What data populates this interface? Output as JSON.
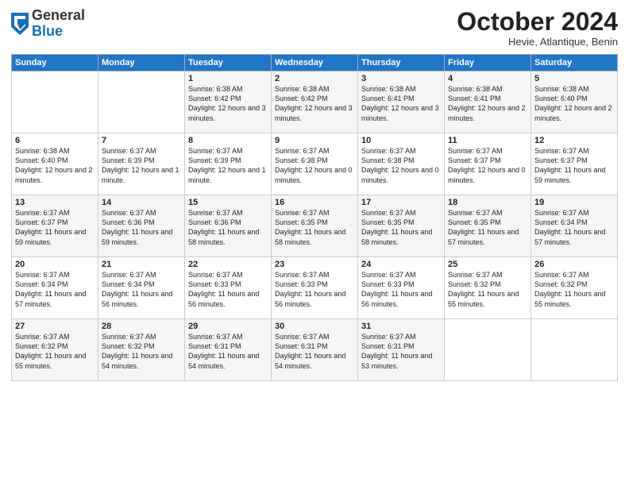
{
  "logo": {
    "general": "General",
    "blue": "Blue"
  },
  "header": {
    "month": "October 2024",
    "location": "Hevie, Atlantique, Benin"
  },
  "days_of_week": [
    "Sunday",
    "Monday",
    "Tuesday",
    "Wednesday",
    "Thursday",
    "Friday",
    "Saturday"
  ],
  "weeks": [
    [
      {
        "day": "",
        "detail": ""
      },
      {
        "day": "",
        "detail": ""
      },
      {
        "day": "1",
        "detail": "Sunrise: 6:38 AM\nSunset: 6:42 PM\nDaylight: 12 hours and 3 minutes."
      },
      {
        "day": "2",
        "detail": "Sunrise: 6:38 AM\nSunset: 6:42 PM\nDaylight: 12 hours and 3 minutes."
      },
      {
        "day": "3",
        "detail": "Sunrise: 6:38 AM\nSunset: 6:41 PM\nDaylight: 12 hours and 3 minutes."
      },
      {
        "day": "4",
        "detail": "Sunrise: 6:38 AM\nSunset: 6:41 PM\nDaylight: 12 hours and 2 minutes."
      },
      {
        "day": "5",
        "detail": "Sunrise: 6:38 AM\nSunset: 6:40 PM\nDaylight: 12 hours and 2 minutes."
      }
    ],
    [
      {
        "day": "6",
        "detail": "Sunrise: 6:38 AM\nSunset: 6:40 PM\nDaylight: 12 hours and 2 minutes."
      },
      {
        "day": "7",
        "detail": "Sunrise: 6:37 AM\nSunset: 6:39 PM\nDaylight: 12 hours and 1 minute."
      },
      {
        "day": "8",
        "detail": "Sunrise: 6:37 AM\nSunset: 6:39 PM\nDaylight: 12 hours and 1 minute."
      },
      {
        "day": "9",
        "detail": "Sunrise: 6:37 AM\nSunset: 6:38 PM\nDaylight: 12 hours and 0 minutes."
      },
      {
        "day": "10",
        "detail": "Sunrise: 6:37 AM\nSunset: 6:38 PM\nDaylight: 12 hours and 0 minutes."
      },
      {
        "day": "11",
        "detail": "Sunrise: 6:37 AM\nSunset: 6:37 PM\nDaylight: 12 hours and 0 minutes."
      },
      {
        "day": "12",
        "detail": "Sunrise: 6:37 AM\nSunset: 6:37 PM\nDaylight: 11 hours and 59 minutes."
      }
    ],
    [
      {
        "day": "13",
        "detail": "Sunrise: 6:37 AM\nSunset: 6:37 PM\nDaylight: 11 hours and 59 minutes."
      },
      {
        "day": "14",
        "detail": "Sunrise: 6:37 AM\nSunset: 6:36 PM\nDaylight: 11 hours and 59 minutes."
      },
      {
        "day": "15",
        "detail": "Sunrise: 6:37 AM\nSunset: 6:36 PM\nDaylight: 11 hours and 58 minutes."
      },
      {
        "day": "16",
        "detail": "Sunrise: 6:37 AM\nSunset: 6:35 PM\nDaylight: 11 hours and 58 minutes."
      },
      {
        "day": "17",
        "detail": "Sunrise: 6:37 AM\nSunset: 6:35 PM\nDaylight: 11 hours and 58 minutes."
      },
      {
        "day": "18",
        "detail": "Sunrise: 6:37 AM\nSunset: 6:35 PM\nDaylight: 11 hours and 57 minutes."
      },
      {
        "day": "19",
        "detail": "Sunrise: 6:37 AM\nSunset: 6:34 PM\nDaylight: 11 hours and 57 minutes."
      }
    ],
    [
      {
        "day": "20",
        "detail": "Sunrise: 6:37 AM\nSunset: 6:34 PM\nDaylight: 11 hours and 57 minutes."
      },
      {
        "day": "21",
        "detail": "Sunrise: 6:37 AM\nSunset: 6:34 PM\nDaylight: 11 hours and 56 minutes."
      },
      {
        "day": "22",
        "detail": "Sunrise: 6:37 AM\nSunset: 6:33 PM\nDaylight: 11 hours and 56 minutes."
      },
      {
        "day": "23",
        "detail": "Sunrise: 6:37 AM\nSunset: 6:33 PM\nDaylight: 11 hours and 56 minutes."
      },
      {
        "day": "24",
        "detail": "Sunrise: 6:37 AM\nSunset: 6:33 PM\nDaylight: 11 hours and 56 minutes."
      },
      {
        "day": "25",
        "detail": "Sunrise: 6:37 AM\nSunset: 6:32 PM\nDaylight: 11 hours and 55 minutes."
      },
      {
        "day": "26",
        "detail": "Sunrise: 6:37 AM\nSunset: 6:32 PM\nDaylight: 11 hours and 55 minutes."
      }
    ],
    [
      {
        "day": "27",
        "detail": "Sunrise: 6:37 AM\nSunset: 6:32 PM\nDaylight: 11 hours and 55 minutes."
      },
      {
        "day": "28",
        "detail": "Sunrise: 6:37 AM\nSunset: 6:32 PM\nDaylight: 11 hours and 54 minutes."
      },
      {
        "day": "29",
        "detail": "Sunrise: 6:37 AM\nSunset: 6:31 PM\nDaylight: 11 hours and 54 minutes."
      },
      {
        "day": "30",
        "detail": "Sunrise: 6:37 AM\nSunset: 6:31 PM\nDaylight: 11 hours and 54 minutes."
      },
      {
        "day": "31",
        "detail": "Sunrise: 6:37 AM\nSunset: 6:31 PM\nDaylight: 11 hours and 53 minutes."
      },
      {
        "day": "",
        "detail": ""
      },
      {
        "day": "",
        "detail": ""
      }
    ]
  ]
}
